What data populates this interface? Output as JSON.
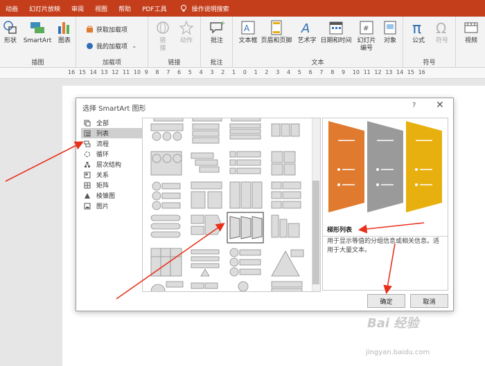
{
  "ribbon_tabs": [
    "动画",
    "幻灯片放映",
    "审阅",
    "视图",
    "帮助",
    "PDF工具"
  ],
  "tell_me": "操作说明搜索",
  "ribbon": {
    "shape": "形状",
    "smartart": "SmartArt",
    "chart": "图表",
    "illustrations": "插图",
    "get_addins": "获取加载项",
    "my_addins": "我的加载项",
    "addins": "加载项",
    "link_a": "链",
    "link_b": "接",
    "action": "动作",
    "links": "链接",
    "comment": "批注",
    "comments": "批注",
    "textbox": "文本框",
    "header_footer": "页眉和页脚",
    "wordart": "艺术字",
    "datetime": "日期和时间",
    "slide_num_a": "幻灯片",
    "slide_num_b": "编号",
    "object": "对象",
    "text": "文本",
    "equation": "公式",
    "symbol": "符号",
    "symbols": "符号",
    "video": "视频"
  },
  "ruler_numbers": [
    "16",
    "15",
    "14",
    "13",
    "12",
    "11",
    "10",
    "9",
    "8",
    "7",
    "6",
    "5",
    "4",
    "3",
    "2",
    "1",
    "0",
    "1",
    "2",
    "3",
    "4",
    "5",
    "6",
    "7",
    "8",
    "9",
    "10",
    "11",
    "12",
    "13",
    "14",
    "15",
    "16"
  ],
  "dialog": {
    "title": "选择 SmartArt 图形",
    "help": "?",
    "close": "✕",
    "categories": [
      "全部",
      "列表",
      "流程",
      "循环",
      "层次结构",
      "关系",
      "矩阵",
      "棱锥图",
      "图片"
    ],
    "selected_category": "列表",
    "preview_title": "梯形列表",
    "preview_desc": "用于显示等值的分组信息或相关信息。适用于大量文本。",
    "ok": "确定",
    "cancel": "取消"
  },
  "preview_colors": [
    "#e07a2e",
    "#9a9a9a",
    "#e8b00f"
  ],
  "watermark": "Bai 经验",
  "watermark_url": "jingyan.baidu.com"
}
